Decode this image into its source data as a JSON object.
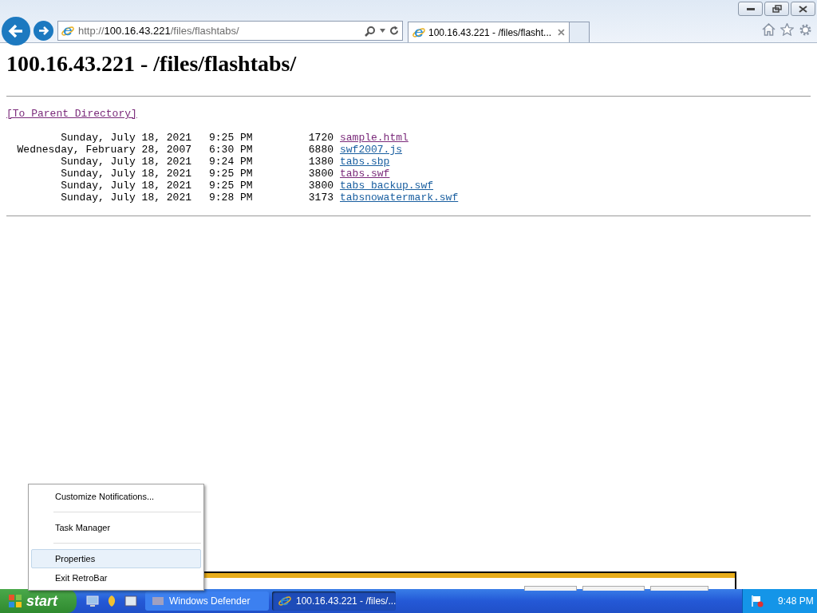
{
  "address_bar": {
    "scheme": "http://",
    "host": "100.16.43.221",
    "path": "/files/flashtabs/"
  },
  "tabs": [
    {
      "label": "100.16.43.221 - /files/flasht...",
      "selected": true
    }
  ],
  "page": {
    "heading": "100.16.43.221 - /files/flashtabs/",
    "parent_link": {
      "label": "[To Parent Directory]",
      "visited": true
    },
    "files": [
      {
        "date": "Sunday, July 18, 2021",
        "time": "9:25 PM",
        "size": "1720",
        "name": "sample.html",
        "visited": true
      },
      {
        "date": "Wednesday, February 28, 2007",
        "time": "6:30 PM",
        "size": "6880",
        "name": "swf2007.js",
        "visited": false
      },
      {
        "date": "Sunday, July 18, 2021",
        "time": "9:24 PM",
        "size": "1380",
        "name": "tabs.sbp",
        "visited": false
      },
      {
        "date": "Sunday, July 18, 2021",
        "time": "9:25 PM",
        "size": "3800",
        "name": "tabs.swf",
        "visited": true
      },
      {
        "date": "Sunday, July 18, 2021",
        "time": "9:25 PM",
        "size": "3800",
        "name": "tabs backup.swf",
        "visited": false
      },
      {
        "date": "Sunday, July 18, 2021",
        "time": "9:28 PM",
        "size": "3173",
        "name": "tabsnowatermark.swf",
        "visited": false
      }
    ]
  },
  "context_menu": {
    "items": [
      {
        "label": "Customize Notifications...",
        "selected": false
      },
      {
        "label": "Task Manager",
        "selected": false
      },
      {
        "label": "Properties",
        "selected": true
      },
      {
        "label": "Exit RetroBar",
        "selected": false
      }
    ]
  },
  "taskbar": {
    "start": "start",
    "buttons": [
      {
        "label": "Windows Defender",
        "selected": false
      },
      {
        "label": "100.16.43.221 - /files/...",
        "selected": true
      }
    ],
    "clock": "9:48 PM"
  }
}
